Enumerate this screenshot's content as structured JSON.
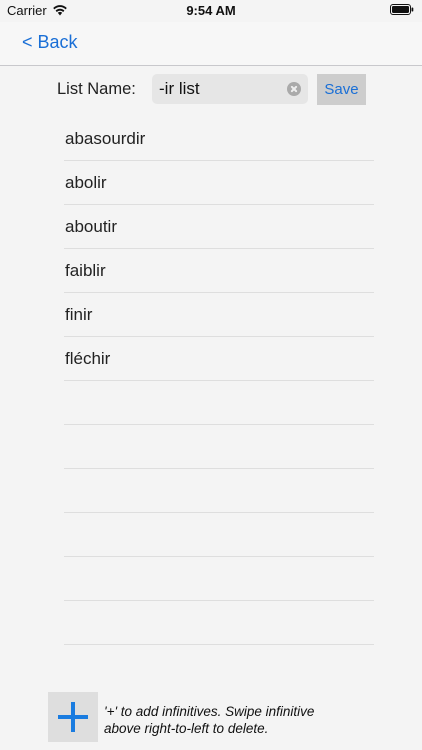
{
  "status_bar": {
    "carrier": "Carrier",
    "time": "9:54 AM"
  },
  "nav": {
    "back_label": "< Back"
  },
  "list_name": {
    "label": "List Name:",
    "value": "-ir list",
    "save_label": "Save"
  },
  "words": [
    "abasourdir",
    "abolir",
    "aboutir",
    "faiblir",
    "finir",
    "fléchir",
    "",
    "",
    "",
    "",
    "",
    ""
  ],
  "footer": {
    "add_icon": "plus-icon",
    "hint": "'+' to add infinitives. Swipe infinitive above right-to-left to delete."
  },
  "colors": {
    "accent": "#1a6fd6",
    "plus": "#1a7ce0",
    "background": "#f4f4f4"
  }
}
